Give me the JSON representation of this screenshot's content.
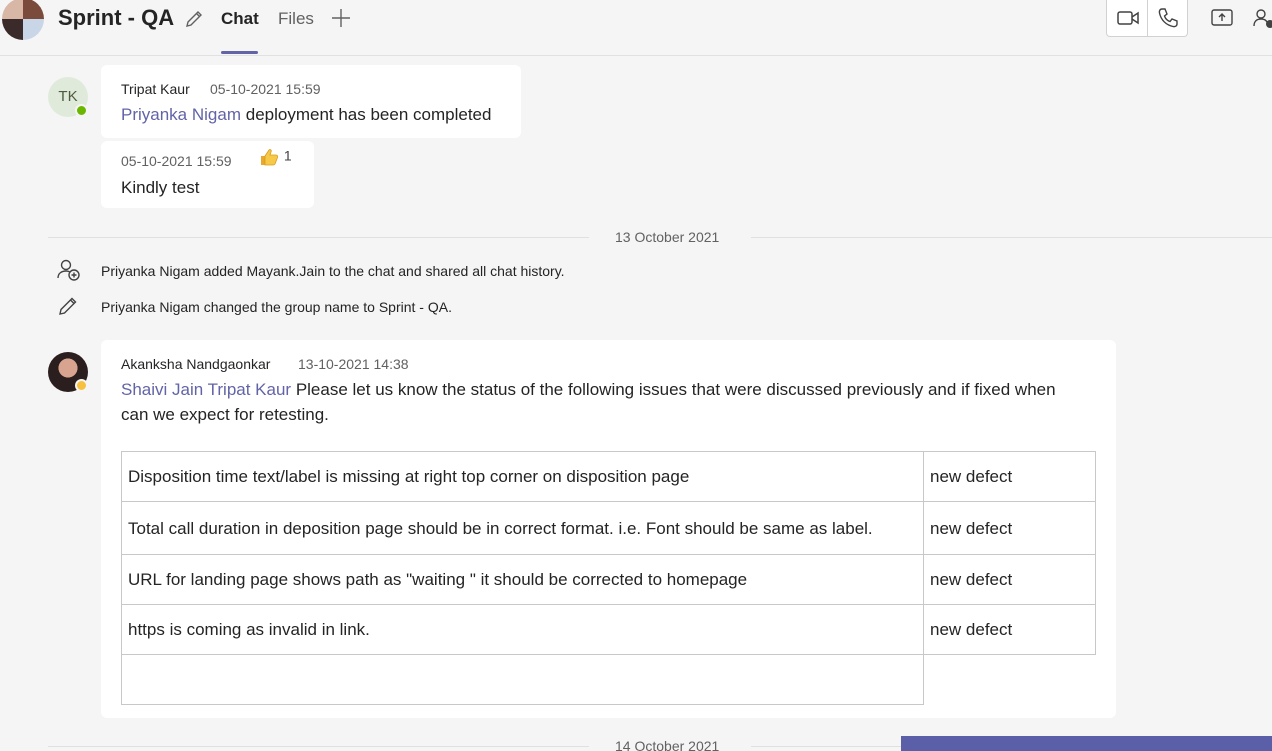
{
  "header": {
    "title": "Sprint - QA",
    "tabs": [
      {
        "label": "Chat",
        "active": true
      },
      {
        "label": "Files",
        "active": false
      }
    ],
    "icons": [
      "edit-icon",
      "add-tab-icon",
      "video-call-icon",
      "phone-call-icon",
      "share-screen-icon",
      "people-icon"
    ]
  },
  "messages": [
    {
      "author": "Tripat Kaur",
      "initials": "TK",
      "timestamp": "05-10-2021 15:59",
      "mention": "Priyanka Nigam",
      "text": "deployment has been completed"
    },
    {
      "timestamp": "05-10-2021 15:59",
      "text": "Kindly test",
      "reaction_count": "1"
    }
  ],
  "date_dividers": [
    "13 October 2021",
    "14 October 2021"
  ],
  "system_events": [
    "Priyanka Nigam added Mayank.Jain to the chat and shared all chat history.",
    "Priyanka Nigam changed the group name to Sprint - QA."
  ],
  "akanksha_message": {
    "author": "Akanksha Nandgaonkar",
    "timestamp": "13-10-2021 14:38",
    "mentions": "Shaivi Jain Tripat Kaur",
    "text_line1": " Please let us know the status of the following issues that were discussed previously and if fixed when",
    "text_line2": "can we expect for retesting.",
    "table": [
      [
        "Disposition time text/label is missing at right top corner on disposition page",
        "new defect"
      ],
      [
        "Total call duration in deposition page should be in correct format. i.e. Font should be same as label.",
        "new defect"
      ],
      [
        "URL for landing page shows path as \"waiting \" it should be corrected to homepage",
        "new defect"
      ],
      [
        "https is coming as invalid in link.",
        "new defect"
      ]
    ]
  },
  "colors": {
    "accent": "#6264a7",
    "presence_available": "#6bb700",
    "presence_away": "#f8c03f"
  }
}
